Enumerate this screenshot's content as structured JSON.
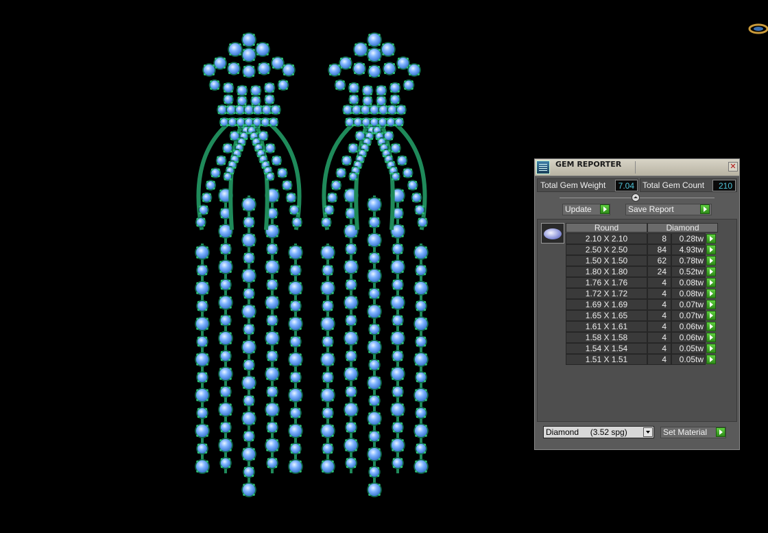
{
  "panel": {
    "title": "GEM REPORTER",
    "close_glyph": "✕",
    "total_gem_weight_label": "Total Gem Weight",
    "total_gem_weight_value": "7.04",
    "total_gem_count_label": "Total Gem Count",
    "total_gem_count_value": "210",
    "update_label": "Update",
    "save_report_label": "Save Report",
    "table": {
      "columns": [
        "Round",
        "Diamond"
      ],
      "rows": [
        {
          "size": "2.10 X 2.10",
          "count": "8",
          "weight": "0.28tw"
        },
        {
          "size": "2.50 X 2.50",
          "count": "84",
          "weight": "4.93tw"
        },
        {
          "size": "1.50 X 1.50",
          "count": "62",
          "weight": "0.78tw"
        },
        {
          "size": "1.80 X 1.80",
          "count": "24",
          "weight": "0.52tw"
        },
        {
          "size": "1.76 X 1.76",
          "count": "4",
          "weight": "0.08tw"
        },
        {
          "size": "1.72 X 1.72",
          "count": "4",
          "weight": "0.08tw"
        },
        {
          "size": "1.69 X 1.69",
          "count": "4",
          "weight": "0.07tw"
        },
        {
          "size": "1.65 X 1.65",
          "count": "4",
          "weight": "0.07tw"
        },
        {
          "size": "1.61 X 1.61",
          "count": "4",
          "weight": "0.06tw"
        },
        {
          "size": "1.58 X 1.58",
          "count": "4",
          "weight": "0.06tw"
        },
        {
          "size": "1.54 X 1.54",
          "count": "4",
          "weight": "0.05tw"
        },
        {
          "size": "1.51 X 1.51",
          "count": "4",
          "weight": "0.05tw"
        }
      ]
    },
    "material_select_value": "Diamond     (3.52 spg)",
    "set_material_label": "Set Material"
  },
  "icons": {
    "panel_icon": "gem-reporter-icon",
    "gem_thumbnail": "round-diamond-icon",
    "go_button": "green-arrow-icon",
    "dropdown": "chevron-down-icon"
  },
  "colors": {
    "viewport_bg": "#000000",
    "gem_blue": "#7fb4ff",
    "metal_green": "#1f8a5a",
    "value_text": "#4fc3d8"
  }
}
